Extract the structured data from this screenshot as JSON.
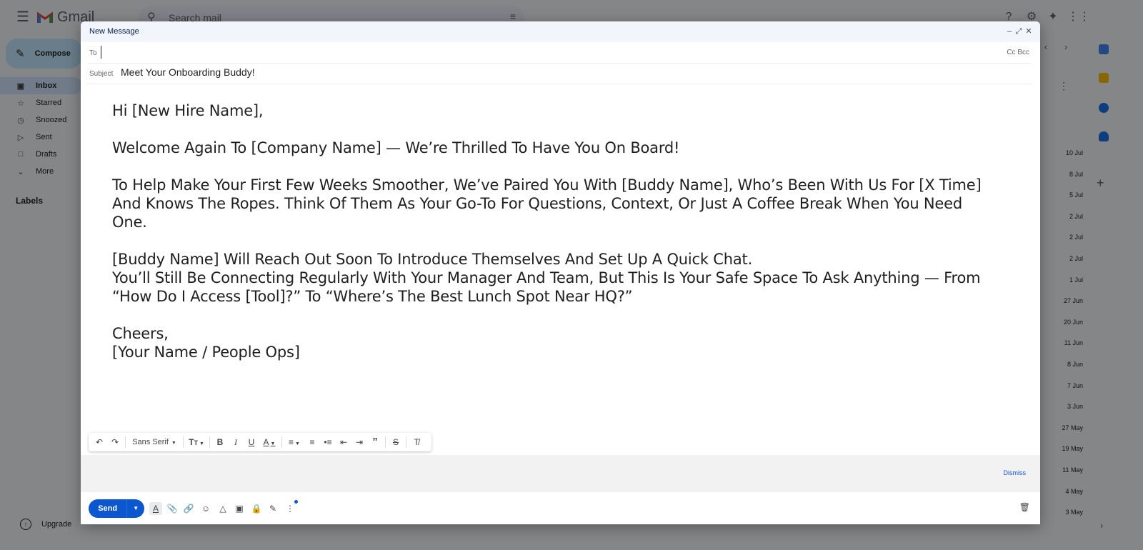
{
  "app": {
    "brand": "Gmail",
    "search_placeholder": "Search mail",
    "compose_label": "Compose",
    "nav": [
      {
        "label": "Inbox",
        "icon": "inbox-icon",
        "active": true
      },
      {
        "label": "Starred",
        "icon": "star-icon"
      },
      {
        "label": "Snoozed",
        "icon": "clock-icon"
      },
      {
        "label": "Sent",
        "icon": "send-icon"
      },
      {
        "label": "Drafts",
        "icon": "draft-icon"
      },
      {
        "label": "More",
        "icon": "chevron-down-icon"
      }
    ],
    "labels_heading": "Labels",
    "upgrade_label": "Upgrade",
    "list_dates": [
      "10 Jul",
      "8 Jul",
      "5 Jul",
      "2 Jul",
      "2 Jul",
      "2 Jul",
      "1 Jul",
      "27 Jun",
      "20 Jun",
      "11 Jun",
      "8 Jun",
      "7 Jun",
      "3 Jun",
      "27 May",
      "19 May",
      "11 May",
      "4 May",
      "3 May"
    ]
  },
  "compose": {
    "title": "New Message",
    "to_label": "To",
    "to_value": "",
    "cc_bcc": "Cc Bcc",
    "subject_label": "Subject",
    "subject_value": "Meet Your Onboarding Buddy!",
    "body": {
      "greeting": "Hi [New Hire Name],",
      "p1": "Welcome Again To [Company Name] — We’re Thrilled To Have You On Board!",
      "p2": "To Help Make Your First Few Weeks Smoother, We’ve Paired You With [Buddy Name], Who’s Been With Us For [X Time] And Knows The Ropes. Think Of Them As Your Go-To For Questions, Context, Or Just A Coffee Break When You Need One.",
      "p3a": "[Buddy Name] Will Reach Out Soon To Introduce Themselves And Set Up A Quick Chat.",
      "p3b": "You’ll Still Be Connecting Regularly With Your Manager And Team, But This Is Your Safe Space To Ask Anything — From “How Do I Access [Tool]?” To “Where’s The Best Lunch Spot Near HQ?”",
      "signoff": "Cheers,",
      "signature": "[Your Name / People Ops]"
    },
    "toolbar": {
      "font": "Sans Serif"
    },
    "dismiss": "Dismiss",
    "send_label": "Send"
  },
  "colors": {
    "send_blue": "#0b57d0",
    "compose_blue": "#c2e7ff",
    "header_bg": "#f2f6fc"
  }
}
